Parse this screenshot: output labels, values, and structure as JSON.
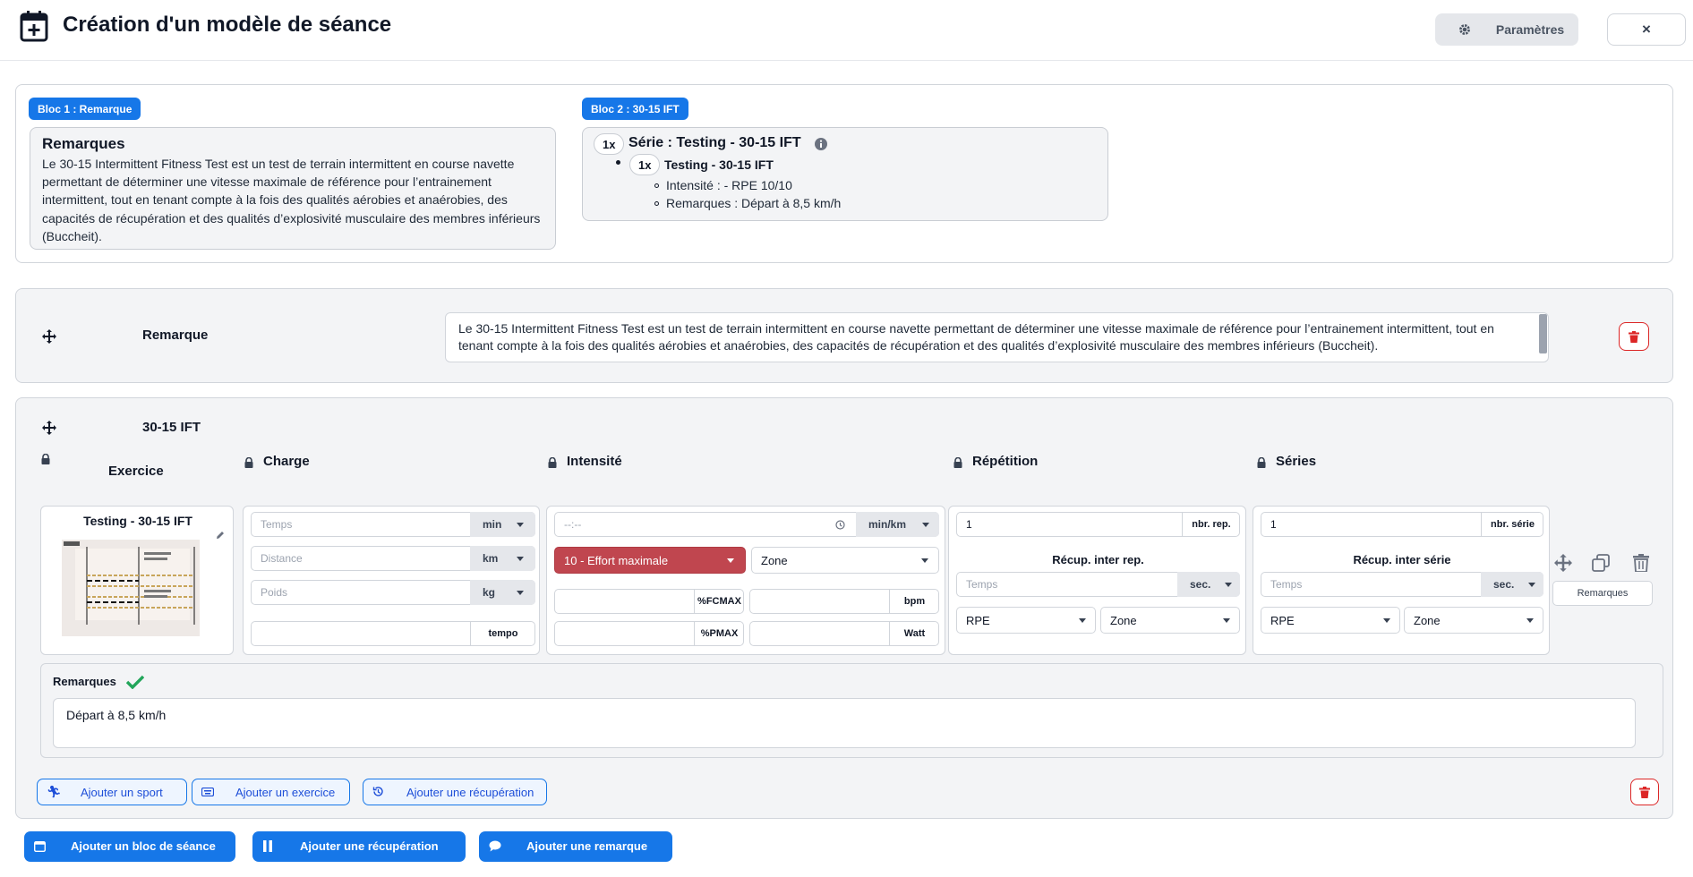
{
  "header": {
    "title": "Création d'un modèle de séance",
    "params_label": "Paramètres",
    "close_label": "×"
  },
  "summary": {
    "bloc1": {
      "tag": "Bloc 1 : Remarque",
      "title": "Remarques",
      "text": "Le 30-15 Intermittent Fitness Test est un test de terrain intermittent en course navette permettant de déterminer une vitesse maximale de référence pour l’entrainement intermittent, tout en tenant compte à la fois des qualités aérobies et anaérobies, des capacités de récupération et des qualités d’explosivité musculaire des membres inférieurs (Buccheit)."
    },
    "bloc2": {
      "tag": "Bloc 2 : 30-15 IFT",
      "serie_count": "1x",
      "serie_title": "Série : Testing - 30-15 IFT",
      "item_count": "1x",
      "item_title": "Testing - 30-15 IFT",
      "details": [
        "Intensité : - RPE 10/10",
        "Remarques : Départ à 8,5 km/h"
      ]
    }
  },
  "remark_block": {
    "label": "Remarque",
    "text": "Le 30-15 Intermittent Fitness Test est un test de terrain intermittent en course navette permettant de déterminer une vitesse maximale de référence pour l’entrainement intermittent, tout en tenant compte à la fois des qualités aérobies et anaérobies, des capacités de récupération et des qualités d’explosivité musculaire des membres inférieurs (Buccheit)."
  },
  "exercise_block": {
    "name": "30-15 IFT",
    "columns": {
      "exercise": "Exercice",
      "charge": "Charge",
      "intensity": "Intensité",
      "repetition": "Répétition",
      "series": "Séries"
    },
    "exercise_card": {
      "title": "Testing - 30-15 IFT"
    },
    "charge": {
      "time_placeholder": "Temps",
      "time_unit": "min",
      "distance_placeholder": "Distance",
      "distance_unit": "km",
      "weight_placeholder": "Poids",
      "weight_unit": "kg",
      "tempo_label": "tempo"
    },
    "intensity": {
      "pace_placeholder": "--:--",
      "pace_unit": "min/km",
      "effort_value": "10 - Effort maximale",
      "zone_value": "Zone",
      "fcmax_unit": "%FCMAX",
      "bpm_unit": "bpm",
      "pmax_unit": "%PMAX",
      "watt_unit": "Watt"
    },
    "repetition": {
      "value": "1",
      "unit": "nbr. rep.",
      "recup_title": "Récup. inter rep.",
      "time_placeholder": "Temps",
      "time_unit": "sec.",
      "rpe_value": "RPE",
      "zone_value": "Zone"
    },
    "series": {
      "value": "1",
      "unit": "nbr. série",
      "recup_title": "Récup. inter série",
      "time_placeholder": "Temps",
      "time_unit": "sec.",
      "rpe_value": "RPE",
      "zone_value": "Zone"
    },
    "remarks_button": "Remarques",
    "remarks_label": "Remarques",
    "remarks_text": "Départ à 8,5 km/h",
    "add_sport": "Ajouter un sport",
    "add_exercise": "Ajouter un exercice",
    "add_recovery": "Ajouter une récupération"
  },
  "footer": {
    "add_block": "Ajouter un bloc de séance",
    "add_recovery": "Ajouter une récupération",
    "add_remark": "Ajouter une remarque"
  },
  "colors": {
    "accent": "#1677e8",
    "danger": "#dc2626",
    "effort_red": "#c0464f",
    "check_green": "#22a55a"
  }
}
